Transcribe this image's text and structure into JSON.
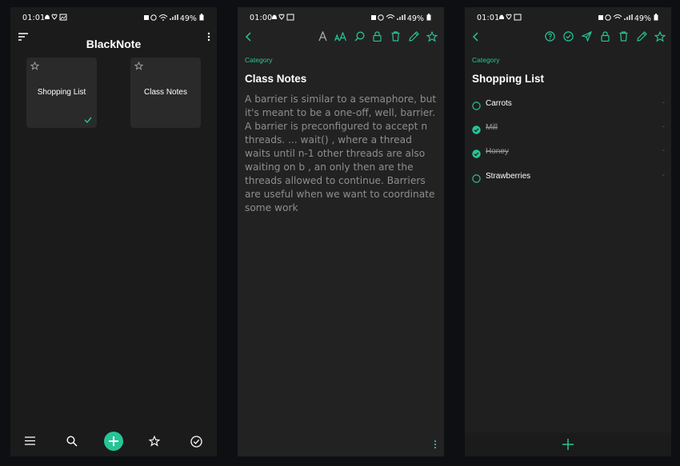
{
  "colors": {
    "accent": "#26c597",
    "bg": "#1b1b1b",
    "card": "#2a2a2a",
    "text": "#ffffff",
    "muted": "#8e8e8e"
  },
  "screen1": {
    "status": {
      "time": "01:01",
      "battery": "49%"
    },
    "app_title": "BlackNote",
    "notes": [
      {
        "title": "Shopping List",
        "starred": false,
        "completed": true
      },
      {
        "title": "Class Notes",
        "starred": false,
        "completed": false
      }
    ],
    "bottom_nav": [
      "menu-icon",
      "search-icon",
      "add-icon",
      "star-icon",
      "check-circle-icon"
    ]
  },
  "screen2": {
    "status": {
      "time": "01:00",
      "battery": "49%"
    },
    "category": "Category",
    "title": "Class Notes",
    "body": "A barrier is similar to a semaphore, but it's meant to be a one-off, well, barrier. A barrier is preconfigured to accept n threads. ... wait() , where a thread waits until n-1 other threads are also waiting on b , an only then are the threads allowed to continue. Barriers are useful when we want to coordinate some work"
  },
  "screen3": {
    "status": {
      "time": "01:01",
      "battery": "49%"
    },
    "category": "Category",
    "title": "Shopping List",
    "items": [
      {
        "label": "Carrots",
        "checked": false
      },
      {
        "label": "Mill",
        "checked": true
      },
      {
        "label": "Honey",
        "checked": true
      },
      {
        "label": "Strawberries",
        "checked": false
      }
    ]
  }
}
